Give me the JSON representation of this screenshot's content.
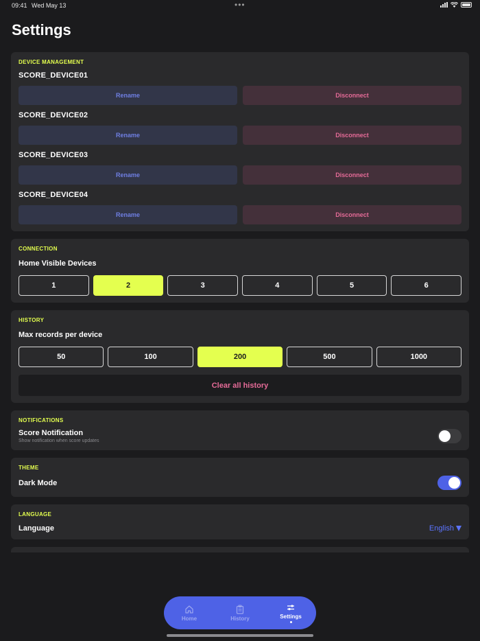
{
  "status_bar": {
    "time": "09:41",
    "date": "Wed May 13",
    "dots": "•••"
  },
  "page": {
    "title": "Settings"
  },
  "device_management": {
    "label": "DEVICE MANAGEMENT",
    "devices": [
      {
        "name": "SCORE_DEVICE01",
        "rename": "Rename",
        "disconnect": "Disconnect"
      },
      {
        "name": "SCORE_DEVICE02",
        "rename": "Rename",
        "disconnect": "Disconnect"
      },
      {
        "name": "SCORE_DEVICE03",
        "rename": "Rename",
        "disconnect": "Disconnect"
      },
      {
        "name": "SCORE_DEVICE04",
        "rename": "Rename",
        "disconnect": "Disconnect"
      }
    ]
  },
  "connection": {
    "label": "CONNECTION",
    "title": "Home Visible Devices",
    "options": [
      "1",
      "2",
      "3",
      "4",
      "5",
      "6"
    ],
    "selected": "2"
  },
  "history": {
    "label": "HISTORY",
    "title": "Max records per device",
    "options": [
      "50",
      "100",
      "200",
      "500",
      "1000"
    ],
    "selected": "200",
    "clear_label": "Clear all history"
  },
  "notifications": {
    "label": "NOTIFICATIONS",
    "title": "Score Notification",
    "subtitle": "Show notification when score updates",
    "enabled": false
  },
  "theme": {
    "label": "THEME",
    "title": "Dark Mode",
    "enabled": true
  },
  "language": {
    "label": "LANGUAGE",
    "title": "Language",
    "value": "English"
  },
  "tabbar": {
    "tabs": [
      {
        "label": "Home",
        "icon": "home-icon",
        "active": false
      },
      {
        "label": "History",
        "icon": "clipboard-icon",
        "active": false
      },
      {
        "label": "Settings",
        "icon": "sliders-icon",
        "active": true
      }
    ]
  },
  "colors": {
    "accent": "#e4ff4f",
    "primary": "#4e62e6",
    "danger": "#e66b98",
    "background": "#1b1b1d",
    "card": "#2a2a2c"
  }
}
